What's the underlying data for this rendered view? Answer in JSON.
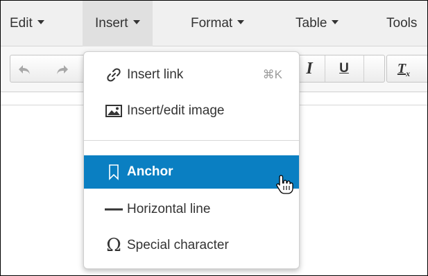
{
  "menubar": {
    "items": [
      {
        "label": "Edit"
      },
      {
        "label": "Insert"
      },
      {
        "label": "Format"
      },
      {
        "label": "Table"
      },
      {
        "label": "Tools"
      }
    ]
  },
  "toolbar": {
    "undo_icon": "undo-icon",
    "redo_icon": "redo-icon",
    "italic_label": "I",
    "underline_label": "U",
    "clear_format_label": "T",
    "clear_format_sub": "x"
  },
  "insert_menu": {
    "items": [
      {
        "label": "Insert link",
        "shortcut": "⌘K",
        "icon": "link-icon"
      },
      {
        "label": "Insert/edit image",
        "icon": "image-icon"
      },
      {
        "label": "Anchor",
        "icon": "bookmark-icon",
        "highlighted": true
      },
      {
        "label": "Horizontal line",
        "icon": "horizontal-line-icon"
      },
      {
        "label": "Special character",
        "icon": "omega-icon"
      }
    ]
  },
  "colors": {
    "highlight": "#0a7fc2",
    "menubar_bg": "#f0f0f0",
    "toolbar_bg": "#f7f7f7"
  }
}
